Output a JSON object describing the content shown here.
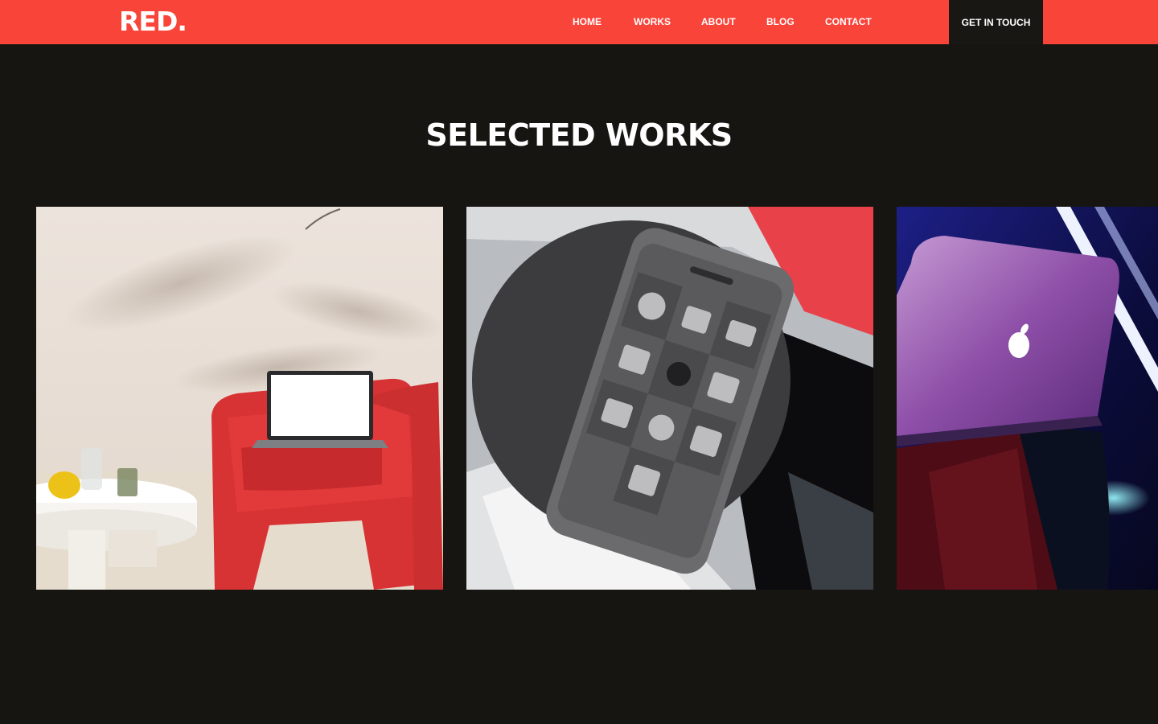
{
  "brand": {
    "logo": "RED."
  },
  "nav": {
    "items": [
      "HOME",
      "WORKS",
      "ABOUT",
      "BLOG",
      "CONTACT"
    ],
    "cta": "GET IN TOUCH"
  },
  "works": {
    "title": "SELECTED WORKS",
    "items": [
      {
        "image": "red-armchair-laptop-photo"
      },
      {
        "image": "smartphone-app-icons-photo"
      },
      {
        "image": "purple-laptop-neon-photo"
      }
    ]
  },
  "colors": {
    "accent": "#f9443a",
    "background": "#171511",
    "cta_background": "#191714",
    "text": "#ffffff"
  },
  "icons": [
    "logo",
    "photo"
  ]
}
